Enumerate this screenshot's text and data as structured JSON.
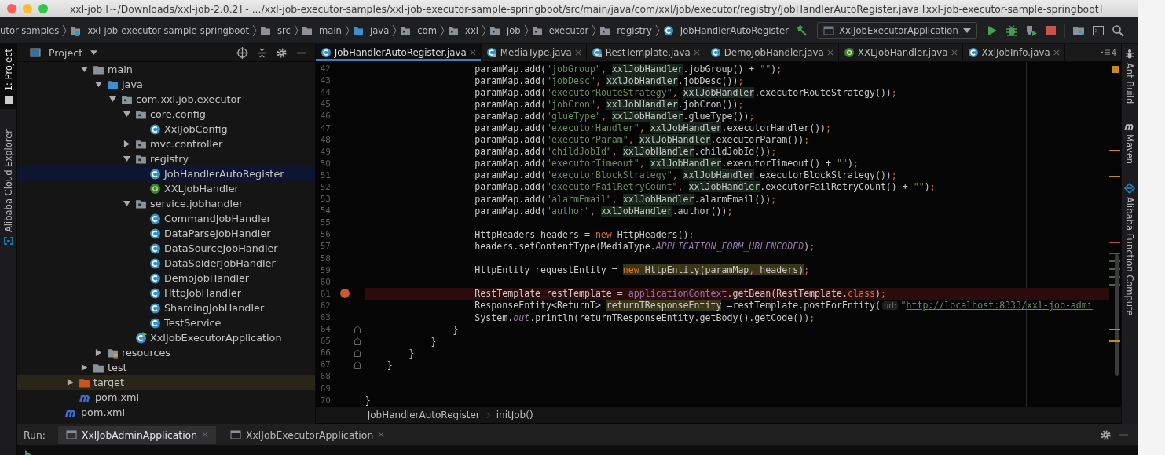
{
  "window": {
    "title": "xxl-job [~/Downloads/xxl-job-2.0.2] - .../xxl-job-executor-samples/xxl-job-executor-sample-springboot/src/main/java/com/xxl/job/executor/registry/JobHandlerAutoRegister.java [xxl-job-executor-sample-springboot]"
  },
  "navbar": {
    "crumbs": [
      {
        "label": "utor-samples",
        "kind": "none"
      },
      {
        "label": "xxl-job-executor-sample-springboot",
        "kind": "module"
      },
      {
        "label": "src",
        "kind": "folder"
      },
      {
        "label": "main",
        "kind": "folder"
      },
      {
        "label": "java",
        "kind": "source"
      },
      {
        "label": "com",
        "kind": "package"
      },
      {
        "label": "xxl",
        "kind": "package"
      },
      {
        "label": "job",
        "kind": "package"
      },
      {
        "label": "executor",
        "kind": "package"
      },
      {
        "label": "registry",
        "kind": "package"
      },
      {
        "label": "JobHandlerAutoRegister",
        "kind": "class"
      }
    ],
    "run_config": "XxlJobExecutorApplication"
  },
  "tool_strip_left": [
    {
      "label": "1: Project",
      "selected": true,
      "kind": "project"
    },
    {
      "label": "Alibaba Cloud Explorer",
      "selected": false,
      "kind": "cloud"
    }
  ],
  "tool_strip_right": [
    {
      "label": "Ant Build",
      "kind": "ant"
    },
    {
      "label": "Maven",
      "kind": "maven"
    },
    {
      "label": "Alibaba Function Compute",
      "kind": "function"
    }
  ],
  "project": {
    "title": "Project",
    "tree": [
      {
        "children": [
          {
            "children": [
              {
                "label": "main",
                "kind": "folder",
                "expanded": true,
                "selected": false,
                "children": [
                  {
                    "label": "java",
                    "kind": "source",
                    "expanded": true,
                    "selected": false,
                    "children": [
                      {
                        "label": "com.xxl.job.executor",
                        "kind": "package",
                        "expanded": true,
                        "selected": false,
                        "children": [
                          {
                            "label": "core.config",
                            "kind": "package",
                            "expanded": true,
                            "selected": false,
                            "children": [
                              {
                                "label": "XxlJobConfig",
                                "kind": "class",
                                "selected": false
                              }
                            ]
                          },
                          {
                            "label": "mvc.controller",
                            "kind": "package",
                            "expanded": false,
                            "selected": false
                          },
                          {
                            "label": "registry",
                            "kind": "package",
                            "expanded": true,
                            "selected": false,
                            "children": [
                              {
                                "label": "JobHandlerAutoRegister",
                                "kind": "class",
                                "selected": true
                              },
                              {
                                "label": "XXLJobHandler",
                                "kind": "annotation",
                                "selected": false
                              }
                            ]
                          },
                          {
                            "label": "service.jobhandler",
                            "kind": "package",
                            "expanded": true,
                            "selected": false,
                            "children": [
                              {
                                "label": "CommandJobHandler",
                                "kind": "class",
                                "selected": false
                              },
                              {
                                "label": "DataParseJobHandler",
                                "kind": "class",
                                "selected": false
                              },
                              {
                                "label": "DataSourceJobHandler",
                                "kind": "class",
                                "selected": false
                              },
                              {
                                "label": "DataSpiderJobHandler",
                                "kind": "class",
                                "selected": false
                              },
                              {
                                "label": "DemoJobHandler",
                                "kind": "class",
                                "selected": false
                              },
                              {
                                "label": "HttpJobHandler",
                                "kind": "class",
                                "selected": false
                              },
                              {
                                "label": "ShardingJobHandler",
                                "kind": "class",
                                "selected": false
                              },
                              {
                                "label": "TestService",
                                "kind": "class",
                                "selected": false
                              }
                            ]
                          },
                          {
                            "label": "XxlJobExecutorApplication",
                            "kind": "app",
                            "selected": false
                          }
                        ]
                      }
                    ]
                  },
                  {
                    "label": "resources",
                    "kind": "resources",
                    "expanded": false,
                    "selected": false
                  }
                ]
              },
              {
                "label": "test",
                "kind": "folder",
                "expanded": false,
                "selected": false
              }
            ]
          },
          {
            "label": "target",
            "kind": "excluded",
            "expanded": false,
            "selected": false
          },
          {
            "label": "pom.xml",
            "kind": "maven",
            "selected": false
          }
        ]
      },
      {
        "label": "pom.xml",
        "kind": "maven",
        "selected": false
      }
    ]
  },
  "editor": {
    "tabs": [
      {
        "label": "JobHandlerAutoRegister.java",
        "kind": "class",
        "locked": false,
        "selected": true
      },
      {
        "label": "MediaType.java",
        "kind": "class",
        "locked": true,
        "selected": false
      },
      {
        "label": "RestTemplate.java",
        "kind": "class",
        "locked": true,
        "selected": false
      },
      {
        "label": "DemoJobHandler.java",
        "kind": "class",
        "locked": false,
        "selected": false
      },
      {
        "label": "XXLJobHandler.java",
        "kind": "annotation",
        "locked": false,
        "selected": false
      },
      {
        "label": "XxlJobInfo.java",
        "kind": "class",
        "locked": false,
        "selected": false
      }
    ],
    "tab_overflow": "4",
    "lines": [
      {
        "number": "42",
        "breakpoint": false,
        "fold": false,
        "tokens": [
          {
            "kind": "plain",
            "text": "                    paramMap.add("
          },
          {
            "kind": "string",
            "text": "\"jobGroup\""
          },
          {
            "kind": "keyword",
            "text": ", "
          },
          {
            "kind": "variable",
            "text": "xxlJobHandler"
          },
          {
            "kind": "plain",
            "text": ".jobGroup() + "
          },
          {
            "kind": "string",
            "text": "\"\""
          },
          {
            "kind": "plain",
            "text": ")"
          },
          {
            "kind": "keyword",
            "text": ";"
          }
        ]
      },
      {
        "number": "43",
        "breakpoint": false,
        "fold": false,
        "tokens": [
          {
            "kind": "plain",
            "text": "                    paramMap.add("
          },
          {
            "kind": "string",
            "text": "\"jobDesc\""
          },
          {
            "kind": "keyword",
            "text": ", "
          },
          {
            "kind": "variable",
            "text": "xxlJobHandler"
          },
          {
            "kind": "plain",
            "text": ".jobDesc())"
          },
          {
            "kind": "keyword",
            "text": ";"
          }
        ]
      },
      {
        "number": "44",
        "breakpoint": false,
        "fold": false,
        "tokens": [
          {
            "kind": "plain",
            "text": "                    paramMap.add("
          },
          {
            "kind": "string",
            "text": "\"executorRouteStrategy\""
          },
          {
            "kind": "keyword",
            "text": ", "
          },
          {
            "kind": "variable",
            "text": "xxlJobHandler"
          },
          {
            "kind": "plain",
            "text": ".executorRouteStrategy())"
          },
          {
            "kind": "keyword",
            "text": ";"
          }
        ]
      },
      {
        "number": "45",
        "breakpoint": false,
        "fold": false,
        "tokens": [
          {
            "kind": "plain",
            "text": "                    paramMap.add("
          },
          {
            "kind": "string",
            "text": "\"jobCron\""
          },
          {
            "kind": "keyword",
            "text": ", "
          },
          {
            "kind": "variable",
            "text": "xxlJobHandler"
          },
          {
            "kind": "plain",
            "text": ".jobCron())"
          },
          {
            "kind": "keyword",
            "text": ";"
          }
        ]
      },
      {
        "number": "46",
        "breakpoint": false,
        "fold": false,
        "tokens": [
          {
            "kind": "plain",
            "text": "                    paramMap.add("
          },
          {
            "kind": "string",
            "text": "\"glueType\""
          },
          {
            "kind": "keyword",
            "text": ", "
          },
          {
            "kind": "variable",
            "text": "xxlJobHandler"
          },
          {
            "kind": "plain",
            "text": ".glueType())"
          },
          {
            "kind": "keyword",
            "text": ";"
          }
        ]
      },
      {
        "number": "47",
        "breakpoint": false,
        "fold": false,
        "tokens": [
          {
            "kind": "plain",
            "text": "                    paramMap.add("
          },
          {
            "kind": "string",
            "text": "\"executorHandler\""
          },
          {
            "kind": "keyword",
            "text": ", "
          },
          {
            "kind": "variable",
            "text": "xxlJobHandler"
          },
          {
            "kind": "plain",
            "text": ".executorHandler())"
          },
          {
            "kind": "keyword",
            "text": ";"
          }
        ]
      },
      {
        "number": "48",
        "breakpoint": false,
        "fold": false,
        "tokens": [
          {
            "kind": "plain",
            "text": "                    paramMap.add("
          },
          {
            "kind": "string",
            "text": "\"executorParam\""
          },
          {
            "kind": "keyword",
            "text": ", "
          },
          {
            "kind": "variable",
            "text": "xxlJobHandler"
          },
          {
            "kind": "plain",
            "text": ".executorParam())"
          },
          {
            "kind": "keyword",
            "text": ";"
          }
        ]
      },
      {
        "number": "49",
        "breakpoint": false,
        "fold": false,
        "tokens": [
          {
            "kind": "plain",
            "text": "                    paramMap.add("
          },
          {
            "kind": "string",
            "text": "\"childJobId\""
          },
          {
            "kind": "keyword",
            "text": ", "
          },
          {
            "kind": "variable",
            "text": "xxlJobHandler"
          },
          {
            "kind": "plain",
            "text": ".childJobId())"
          },
          {
            "kind": "keyword",
            "text": ";"
          }
        ]
      },
      {
        "number": "50",
        "breakpoint": false,
        "fold": false,
        "tokens": [
          {
            "kind": "plain",
            "text": "                    paramMap.add("
          },
          {
            "kind": "string",
            "text": "\"executorTimeout\""
          },
          {
            "kind": "keyword",
            "text": ", "
          },
          {
            "kind": "variable",
            "text": "xxlJobHandler"
          },
          {
            "kind": "plain",
            "text": ".executorTimeout() + "
          },
          {
            "kind": "string",
            "text": "\"\""
          },
          {
            "kind": "plain",
            "text": ")"
          },
          {
            "kind": "keyword",
            "text": ";"
          }
        ]
      },
      {
        "number": "51",
        "breakpoint": false,
        "fold": false,
        "tokens": [
          {
            "kind": "plain",
            "text": "                    paramMap.add("
          },
          {
            "kind": "string",
            "text": "\"executorBlockStrategy\""
          },
          {
            "kind": "keyword",
            "text": ", "
          },
          {
            "kind": "variable",
            "text": "xxlJobHandler"
          },
          {
            "kind": "plain",
            "text": ".executorBlockStrategy())"
          },
          {
            "kind": "keyword",
            "text": ";"
          }
        ]
      },
      {
        "number": "52",
        "breakpoint": false,
        "fold": false,
        "tokens": [
          {
            "kind": "plain",
            "text": "                    paramMap.add("
          },
          {
            "kind": "string",
            "text": "\"executorFailRetryCount\""
          },
          {
            "kind": "keyword",
            "text": ", "
          },
          {
            "kind": "variable",
            "text": "xxlJobHandler"
          },
          {
            "kind": "plain",
            "text": ".executorFailRetryCount() + "
          },
          {
            "kind": "string",
            "text": "\"\""
          },
          {
            "kind": "plain",
            "text": ")"
          },
          {
            "kind": "keyword",
            "text": ";"
          }
        ]
      },
      {
        "number": "53",
        "breakpoint": false,
        "fold": false,
        "tokens": [
          {
            "kind": "plain",
            "text": "                    paramMap.add("
          },
          {
            "kind": "string",
            "text": "\"alarmEmail\""
          },
          {
            "kind": "keyword",
            "text": ", "
          },
          {
            "kind": "variable",
            "text": "xxlJobHandler"
          },
          {
            "kind": "plain",
            "text": ".alarmEmail())"
          },
          {
            "kind": "keyword",
            "text": ";"
          }
        ]
      },
      {
        "number": "54",
        "breakpoint": false,
        "fold": false,
        "tokens": [
          {
            "kind": "plain",
            "text": "                    paramMap.add("
          },
          {
            "kind": "string",
            "text": "\"author\""
          },
          {
            "kind": "keyword",
            "text": ", "
          },
          {
            "kind": "variable",
            "text": "xxlJobHandler"
          },
          {
            "kind": "plain",
            "text": ".author())"
          },
          {
            "kind": "keyword",
            "text": ";"
          }
        ]
      },
      {
        "number": "55",
        "breakpoint": false,
        "fold": false
      },
      {
        "number": "56",
        "breakpoint": false,
        "fold": false,
        "tokens": [
          {
            "kind": "plain",
            "text": "                    HttpHeaders headers = "
          },
          {
            "kind": "keyword",
            "text": "new "
          },
          {
            "kind": "plain",
            "text": "HttpHeaders()"
          },
          {
            "kind": "keyword",
            "text": ";"
          }
        ]
      },
      {
        "number": "57",
        "breakpoint": false,
        "fold": false,
        "tokens": [
          {
            "kind": "plain",
            "text": "                    headers.setContentType(MediaType."
          },
          {
            "kind": "field",
            "text": "APPLICATION_FORM_URLENCODED"
          },
          {
            "kind": "plain",
            "text": ")"
          },
          {
            "kind": "keyword",
            "text": ";"
          }
        ]
      },
      {
        "number": "58",
        "breakpoint": false,
        "fold": false
      },
      {
        "number": "59",
        "breakpoint": false,
        "fold": false,
        "tokens": [
          {
            "kind": "plain",
            "text": "                    HttpEntity requestEntity = "
          },
          {
            "kind": "usage_keyword",
            "text": "new "
          },
          {
            "kind": "usage",
            "text": "HttpEntity(paramMap"
          },
          {
            "kind": "usage_keyword",
            "text": ", "
          },
          {
            "kind": "usage",
            "text": "headers)"
          },
          {
            "kind": "keyword",
            "text": ";"
          }
        ]
      },
      {
        "number": "60",
        "breakpoint": false,
        "fold": false
      },
      {
        "number": "61",
        "breakpoint": true,
        "fold": false,
        "tokens": [
          {
            "kind": "plain",
            "text": "                    RestTemplate restTemplate = "
          },
          {
            "kind": "member",
            "text": "applicationContext"
          },
          {
            "kind": "plain",
            "text": ".getBean(RestTemplate."
          },
          {
            "kind": "keyword",
            "text": "class"
          },
          {
            "kind": "plain",
            "text": ")"
          },
          {
            "kind": "keyword",
            "text": ";"
          }
        ]
      },
      {
        "number": "62",
        "breakpoint": false,
        "fold": false,
        "tokens": [
          {
            "kind": "plain",
            "text": "                    ResponseEntity<ReturnT> "
          },
          {
            "kind": "usage",
            "text": "returnTResponseEntity"
          },
          {
            "kind": "plain",
            "text": " =restTemplate.postForEntity("
          },
          {
            "kind": "hint",
            "text": "url:"
          },
          {
            "kind": "string",
            "text": "\""
          },
          {
            "kind": "url",
            "text": "http://localhost:8333/xxl-job-admi"
          }
        ]
      },
      {
        "number": "63",
        "breakpoint": false,
        "fold": false,
        "tokens": [
          {
            "kind": "plain",
            "text": "                    System."
          },
          {
            "kind": "field",
            "text": "out"
          },
          {
            "kind": "plain",
            "text": ".println(returnTResponseEntity.getBody().getCode())"
          },
          {
            "kind": "keyword",
            "text": ";"
          }
        ]
      },
      {
        "number": "64",
        "breakpoint": false,
        "fold": true,
        "tokens": [
          {
            "kind": "plain",
            "text": "                }"
          }
        ]
      },
      {
        "number": "65",
        "breakpoint": false,
        "fold": true,
        "tokens": [
          {
            "kind": "plain",
            "text": "            }"
          }
        ]
      },
      {
        "number": "66",
        "breakpoint": false,
        "fold": true,
        "tokens": [
          {
            "kind": "plain",
            "text": "        }"
          }
        ]
      },
      {
        "number": "67",
        "breakpoint": false,
        "fold": true,
        "tokens": [
          {
            "kind": "plain",
            "text": "    }"
          }
        ]
      },
      {
        "number": "68",
        "breakpoint": false,
        "fold": false
      },
      {
        "number": "69",
        "breakpoint": false,
        "fold": false
      },
      {
        "number": "70",
        "breakpoint": false,
        "fold": false,
        "tokens": [
          {
            "kind": "plain",
            "text": "}"
          }
        ]
      }
    ],
    "breadcrumb": [
      "JobHandlerAutoRegister",
      "initJob()"
    ]
  },
  "run_panel": {
    "label": "Run:",
    "tabs": [
      {
        "label": "XxlJobAdminApplication",
        "selected": true
      },
      {
        "label": "XxlJobExecutorApplication",
        "selected": false
      }
    ]
  }
}
